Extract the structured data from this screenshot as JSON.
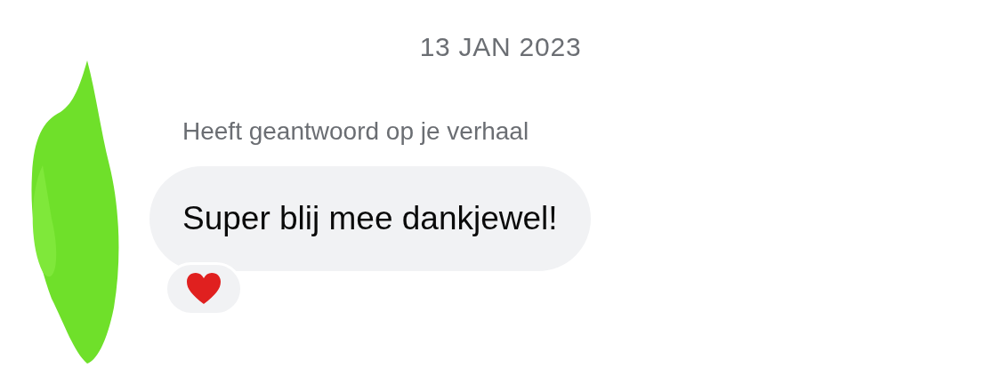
{
  "date_separator": "13 JAN 2023",
  "message": {
    "context": "Heeft geantwoord op je verhaal",
    "text": "Super blij mee dankjewel!",
    "reactions": [
      {
        "kind": "heart"
      }
    ]
  }
}
